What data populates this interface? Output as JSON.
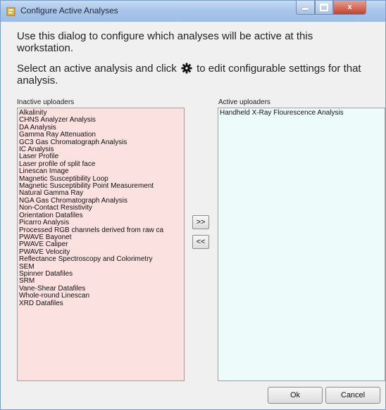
{
  "window": {
    "title": "Configure Active Analyses",
    "minimize_label": "",
    "maximize_label": "",
    "close_label": "x"
  },
  "intro": {
    "line1": "Use this dialog to configure which analyses will be active at this workstation.",
    "line2_before": "Select an active analysis and click",
    "line2_after": "to edit configurable settings for that analysis."
  },
  "inactive": {
    "label": "Inactive uploaders",
    "items": [
      "Alkalinity",
      "CHNS Analyzer Analysis",
      "DA Analysis",
      "Gamma Ray Attenuation",
      "GC3 Gas Chromatograph Analysis",
      "IC Analysis",
      "Laser Profile",
      "Laser profile of split face",
      "Linescan Image",
      "Magnetic Susceptibility Loop",
      "Magnetic Susceptibility Point Measurement",
      "Natural Gamma Ray",
      "NGA Gas Chromatograph Analysis",
      "Non-Contact Resistivity",
      "Orientation Datafiles",
      "Picarro Analysis",
      "Processed RGB channels derived from raw ca",
      "PWAVE Bayonet",
      "PWAVE Caliper",
      "PWAVE Velocity",
      "Reflectance Spectroscopy and Colorimetry",
      "SEM",
      "Spinner Datafiles",
      "SRM",
      "Vane-Shear Datafiles",
      "Whole-round Linescan",
      "XRD Datafiles"
    ]
  },
  "active": {
    "label": "Active uploaders",
    "items": [
      "Handheld X-Ray Flourescence Analysis"
    ]
  },
  "buttons": {
    "add": ">>",
    "remove": "<<",
    "ok": "Ok",
    "cancel": "Cancel"
  },
  "colors": {
    "inactive_bg": "#fbe1df",
    "active_bg": "#eefbfb",
    "titlebar": "#a9c6ea"
  },
  "icons": {
    "app": "app-icon",
    "gear": "gear-icon"
  }
}
